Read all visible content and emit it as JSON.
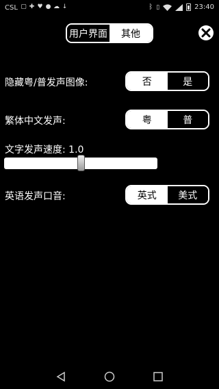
{
  "status_bar": {
    "carrier": "CSL",
    "time": "23:40",
    "left_icons": [
      "sim-icon",
      "game-icon",
      "heart-icon",
      "chat-icon",
      "cloud-icon",
      "download-icon"
    ],
    "right_icons": [
      "bluetooth-icon",
      "vibrate-icon",
      "wifi-icon",
      "signal-icon",
      "battery-icon"
    ]
  },
  "top_tabs": {
    "items": [
      {
        "label": "用户界面",
        "selected": true
      },
      {
        "label": "其他",
        "selected": false
      }
    ]
  },
  "close_button": {
    "icon": "close-icon"
  },
  "settings": {
    "hide_image": {
      "label": "隐藏粤/普发声图像:",
      "options": [
        "否",
        "是"
      ],
      "selected": "否"
    },
    "traditional_voice": {
      "label": "繁体中文发声:",
      "options": [
        "粤",
        "普"
      ],
      "selected": "粤"
    },
    "speech_rate": {
      "label": "文字发声速度: 1.0",
      "value": 1.0,
      "min": 0.0,
      "max": 2.0
    },
    "english_accent": {
      "label": "英语发声口音:",
      "options": [
        "英式",
        "美式"
      ],
      "selected": "英式"
    }
  },
  "nav_bar": {
    "buttons": [
      "back-icon",
      "home-icon",
      "recents-icon"
    ]
  }
}
